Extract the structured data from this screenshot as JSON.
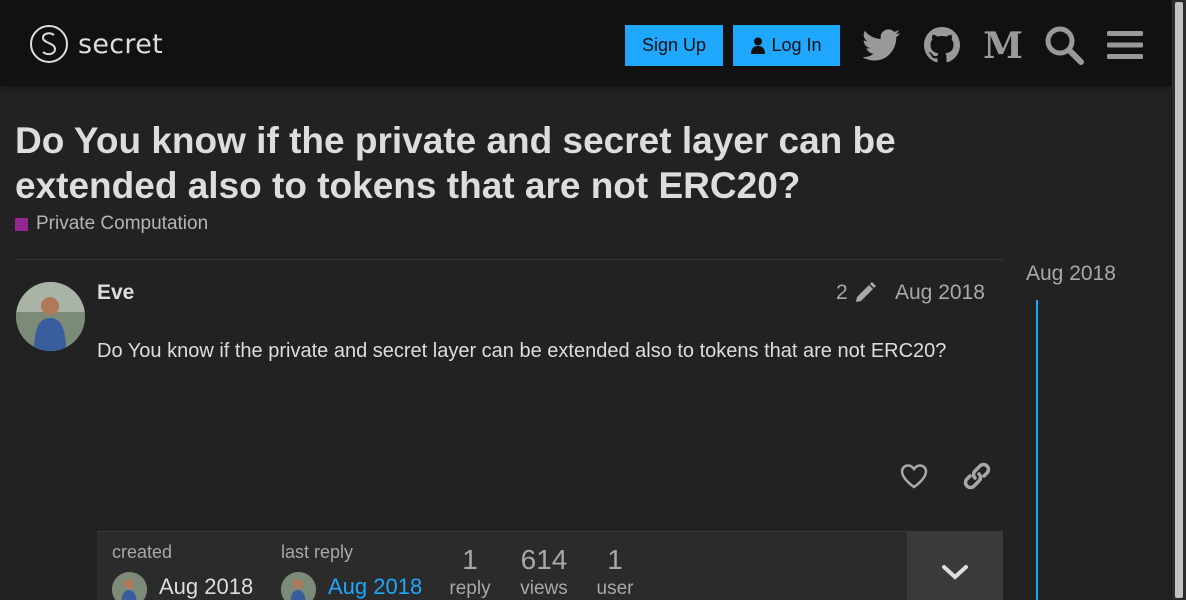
{
  "header": {
    "logo_text": "secret",
    "signup_label": "Sign Up",
    "login_label": "Log In",
    "icons": [
      "twitter-icon",
      "github-icon",
      "medium-icon",
      "search-icon",
      "hamburger-menu-icon"
    ]
  },
  "topic": {
    "title": "Do You know if the private and secret layer can be extended also to tokens that are not ERC20?",
    "category": "Private Computation",
    "category_color": "#92278f"
  },
  "post": {
    "username": "Eve",
    "edit_count": "2",
    "date": "Aug 2018",
    "body": "Do You know if the private and secret layer can be extended also to tokens that are not ERC20?"
  },
  "topic_map": {
    "created_label": "created",
    "created_date": "Aug 2018",
    "last_reply_label": "last reply",
    "last_reply_date": "Aug 2018",
    "replies_num": "1",
    "replies_label": "reply",
    "views_num": "614",
    "views_label": "views",
    "users_num": "1",
    "users_label": "user"
  },
  "timeline": {
    "date": "Aug 2018"
  },
  "colors": {
    "accent": "#1ea7fd",
    "background": "#222222",
    "header": "#111111"
  }
}
